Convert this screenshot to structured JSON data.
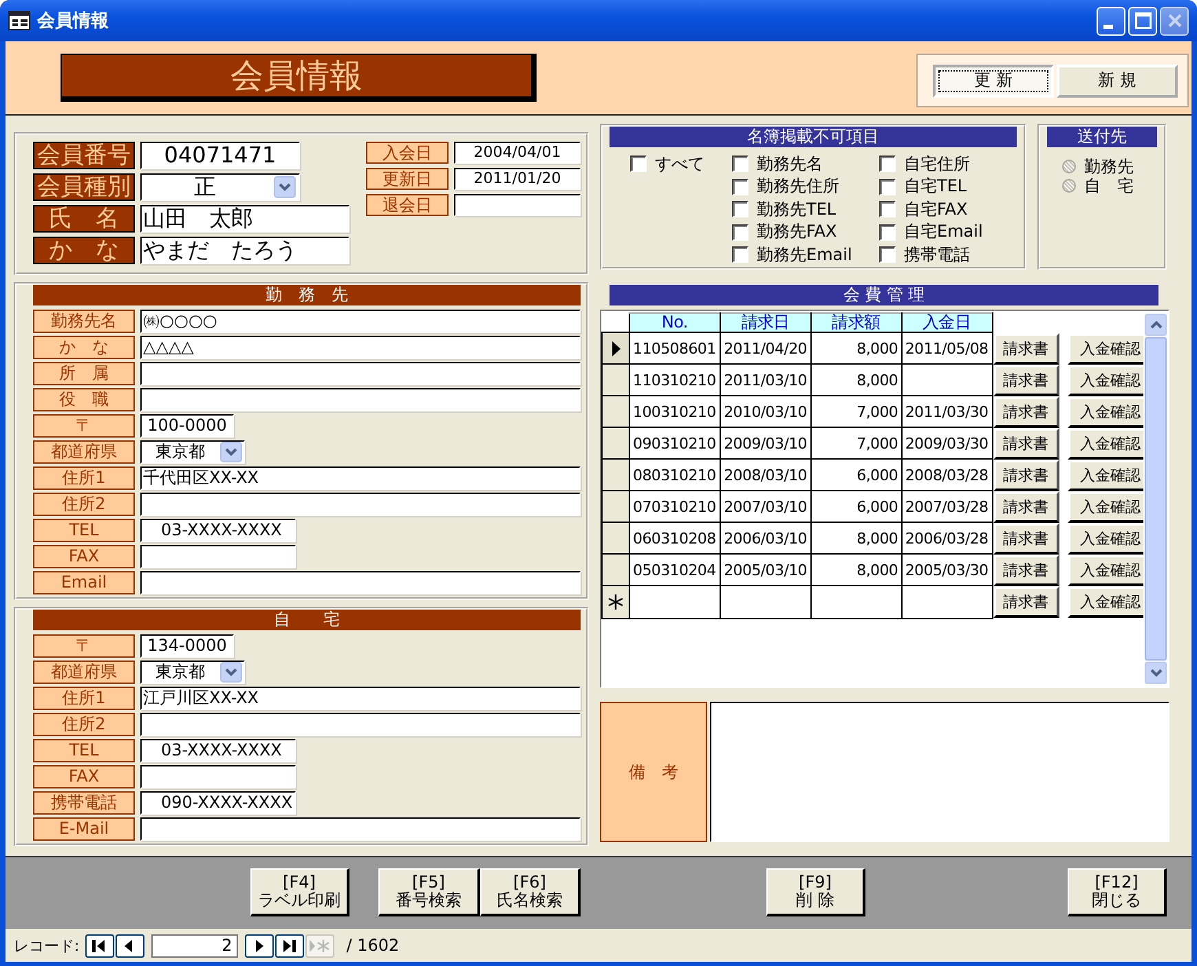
{
  "window": {
    "title": "会員情報",
    "close_disabled": true
  },
  "header": {
    "title": "会員情報",
    "buttons": [
      {
        "label": "更 新",
        "selected": true
      },
      {
        "label": "新 規",
        "selected": false
      }
    ]
  },
  "member": {
    "fields": [
      {
        "label": "会員番号",
        "value": "04071471",
        "kind": "code"
      },
      {
        "label": "会員種別",
        "value": "正",
        "kind": "combo"
      },
      {
        "label": "氏　名",
        "value": "山田　太郎",
        "kind": "name"
      },
      {
        "label": "か　な",
        "value": "やまだ　たろう",
        "kind": "name"
      }
    ],
    "dates": [
      {
        "label": "入会日",
        "value": "2004/04/01"
      },
      {
        "label": "更新日",
        "value": "2011/01/20"
      },
      {
        "label": "退会日"
      }
    ]
  },
  "exclusions": {
    "title": "名簿掲載不可項目",
    "all": {
      "label": "すべて",
      "checked": false
    },
    "items": [
      {
        "label": "勤務先名",
        "checked": false
      },
      {
        "label": "勤務先住所",
        "checked": false
      },
      {
        "label": "勤務先TEL",
        "checked": false
      },
      {
        "label": "勤務先FAX",
        "checked": false
      },
      {
        "label": "勤務先Email",
        "checked": false
      },
      {
        "label": "自宅住所",
        "checked": false
      },
      {
        "label": "自宅TEL",
        "checked": false
      },
      {
        "label": "自宅FAX",
        "checked": false
      },
      {
        "label": "自宅Email",
        "checked": false
      },
      {
        "label": "携帯電話",
        "checked": false
      }
    ]
  },
  "delivery": {
    "title": "送付先",
    "options": [
      {
        "label": "勤務先",
        "selected": false
      },
      {
        "label": "自　宅",
        "selected": false
      }
    ]
  },
  "workplace": {
    "title": "勤　務　先",
    "fields": [
      {
        "label": "勤務先名",
        "value": "㈱○○○○",
        "kind": "full"
      },
      {
        "label": "か　な",
        "value": "△△△△",
        "kind": "full"
      },
      {
        "label": "所　属",
        "kind": "full"
      },
      {
        "label": "役　職",
        "kind": "full"
      },
      {
        "label": "〒",
        "value": "100-0000",
        "kind": "zip"
      },
      {
        "label": "都道府県",
        "value": "東京都",
        "kind": "combo"
      },
      {
        "label": "住所1",
        "value": "千代田区XX-XX",
        "kind": "full"
      },
      {
        "label": "住所2",
        "kind": "full"
      },
      {
        "label": "TEL",
        "value": "03-XXXX-XXXX",
        "kind": "tel"
      },
      {
        "label": "FAX",
        "kind": "tel"
      },
      {
        "label": "Email",
        "kind": "full"
      }
    ]
  },
  "home": {
    "title": "自　　宅",
    "fields": [
      {
        "label": "〒",
        "value": "134-0000",
        "kind": "zip"
      },
      {
        "label": "都道府県",
        "value": "東京都",
        "kind": "combo"
      },
      {
        "label": "住所1",
        "value": "江戸川区XX-XX",
        "kind": "full"
      },
      {
        "label": "住所2",
        "kind": "full"
      },
      {
        "label": "TEL",
        "value": "03-XXXX-XXXX",
        "kind": "tel"
      },
      {
        "label": "FAX",
        "kind": "tel"
      },
      {
        "label": "携帯電話",
        "value": "090-XXXX-XXXX",
        "kind": "tel"
      },
      {
        "label": "E-Mail",
        "kind": "full"
      }
    ]
  },
  "fees": {
    "title": "会 費 管 理",
    "columns": [
      "No.",
      "請求日",
      "請求額",
      "入金日"
    ],
    "rows": [
      {
        "kind": "record",
        "selected": true,
        "no": "110508601",
        "billed": "2011/04/20",
        "amount": "8,000",
        "paid": "2011/05/08",
        "actions": [
          "請求書",
          "入金確認"
        ]
      },
      {
        "kind": "record",
        "selected": false,
        "no": "110310210",
        "billed": "2011/03/10",
        "amount": "8,000",
        "actions": [
          "請求書",
          "入金確認"
        ]
      },
      {
        "kind": "record",
        "selected": false,
        "no": "100310210",
        "billed": "2010/03/10",
        "amount": "7,000",
        "paid": "2011/03/30",
        "actions": [
          "請求書",
          "入金確認"
        ]
      },
      {
        "kind": "record",
        "selected": false,
        "no": "090310210",
        "billed": "2009/03/10",
        "amount": "7,000",
        "paid": "2009/03/30",
        "actions": [
          "請求書",
          "入金確認"
        ]
      },
      {
        "kind": "record",
        "selected": false,
        "no": "080310210",
        "billed": "2008/03/10",
        "amount": "6,000",
        "paid": "2008/03/28",
        "actions": [
          "請求書",
          "入金確認"
        ]
      },
      {
        "kind": "record",
        "selected": false,
        "no": "070310210",
        "billed": "2007/03/10",
        "amount": "6,000",
        "paid": "2007/03/28",
        "actions": [
          "請求書",
          "入金確認"
        ]
      },
      {
        "kind": "record",
        "selected": false,
        "no": "060310208",
        "billed": "2006/03/10",
        "amount": "8,000",
        "paid": "2006/03/28",
        "actions": [
          "請求書",
          "入金確認"
        ]
      },
      {
        "kind": "record",
        "selected": false,
        "no": "050310204",
        "billed": "2005/03/10",
        "amount": "8,000",
        "paid": "2005/03/30",
        "actions": [
          "請求書",
          "入金確認"
        ]
      },
      {
        "kind": "new",
        "selected": false,
        "actions": [
          "請求書",
          "入金確認"
        ]
      }
    ]
  },
  "notes": {
    "label": "備　考"
  },
  "footer": {
    "buttons": [
      {
        "key": "[F4]",
        "label": "ラベル印刷"
      },
      {
        "key": "[F5]",
        "label": "番号検索"
      },
      {
        "key": "[F6]",
        "label": "氏名検索"
      },
      {
        "key": "[F9]",
        "label": "削 除"
      },
      {
        "key": "[F12]",
        "label": "閉じる"
      }
    ]
  },
  "record": {
    "label": "レコード:",
    "current": "2",
    "total": "/ 1602",
    "nav": [
      {
        "kind": "first",
        "disabled": false
      },
      {
        "kind": "prev",
        "disabled": false
      },
      {
        "kind": "next",
        "disabled": false
      },
      {
        "kind": "last",
        "disabled": false
      },
      {
        "kind": "new",
        "disabled": true
      }
    ]
  }
}
